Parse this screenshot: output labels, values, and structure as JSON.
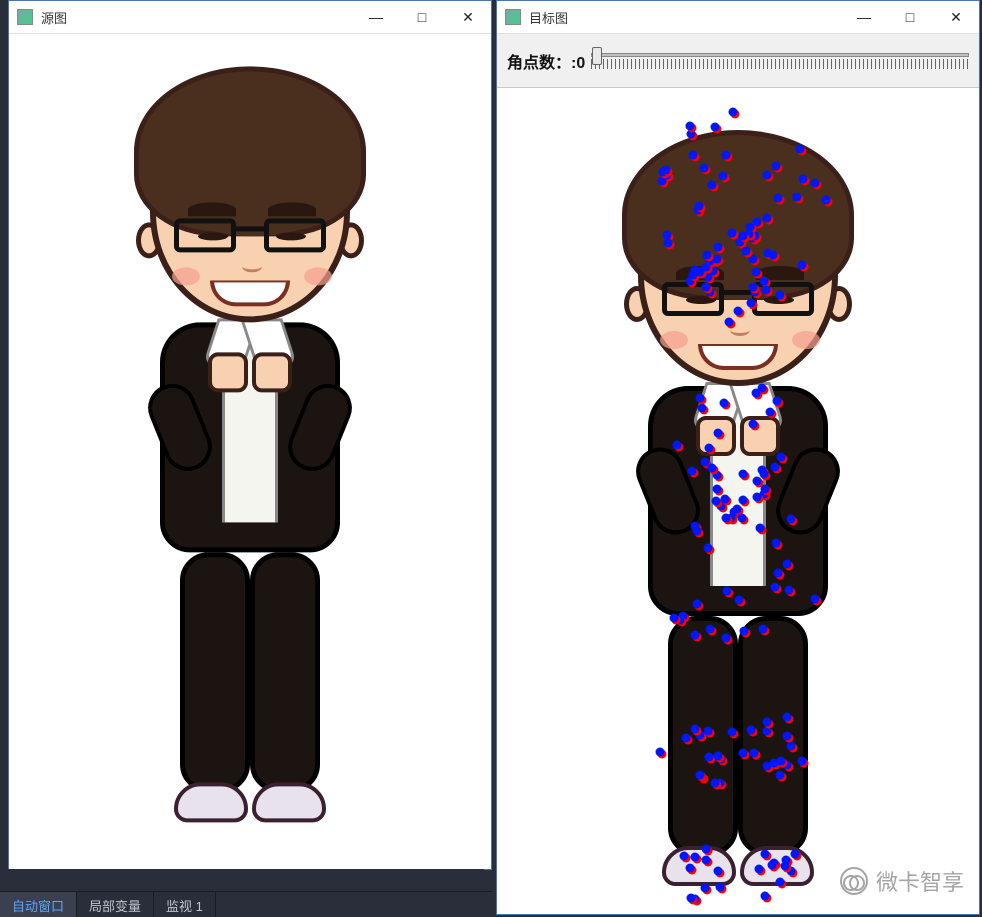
{
  "windows": {
    "source": {
      "title": "源图",
      "controls": {
        "min": "—",
        "max": "□",
        "close": "✕"
      }
    },
    "target": {
      "title": "目标图",
      "controls": {
        "min": "—",
        "max": "□",
        "close": "✕"
      },
      "slider": {
        "label": "角点数：:",
        "value": "0"
      }
    }
  },
  "tabs": {
    "auto_window": "自动窗口",
    "local_vars": "局部变量",
    "watch_1": "监视 1"
  },
  "watermark": "微卡智享"
}
